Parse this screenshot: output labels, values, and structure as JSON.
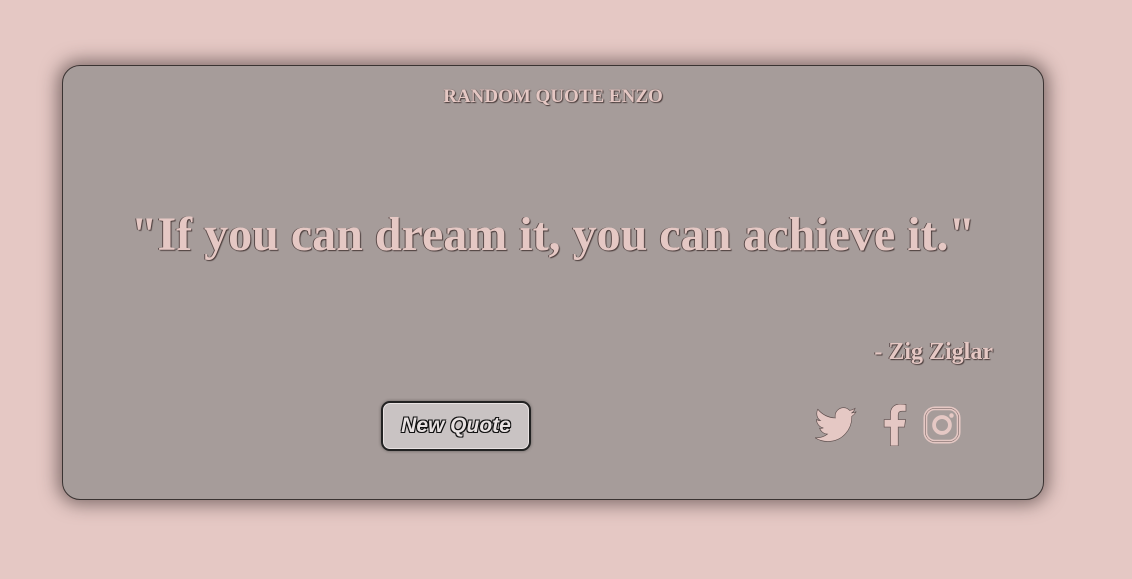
{
  "app": {
    "title": "RANDOM QUOTE ENZO"
  },
  "quote": {
    "text": "\"If you can dream it, you can achieve it.\"",
    "author": "- Zig Ziglar"
  },
  "actions": {
    "new_quote_label": "New Quote"
  },
  "social": {
    "icons": [
      "twitter-icon",
      "facebook-icon",
      "instagram-icon"
    ]
  },
  "colors": {
    "background": "#e5c8c4",
    "card": "#a69c9a",
    "text": "#e5c8c4",
    "button": "#c9c3c3"
  }
}
